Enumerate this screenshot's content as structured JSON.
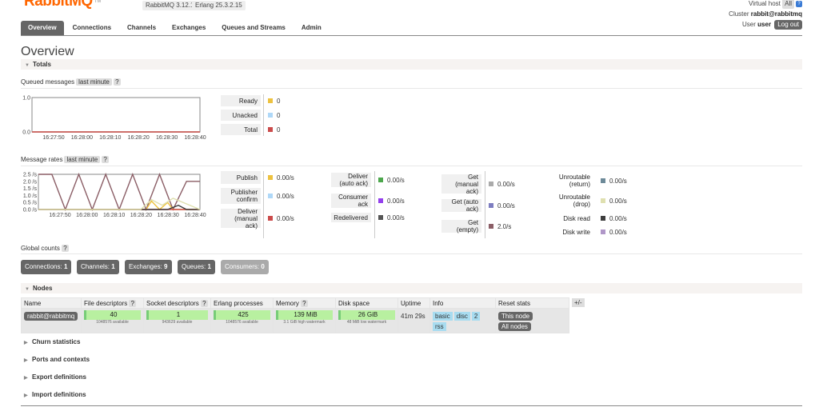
{
  "header": {
    "logo_text": "RabbitMQ",
    "logo_tm": "TM",
    "rabbitmq_version": "RabbitMQ 3.12.14",
    "erlang_version": "Erlang 25.3.2.15",
    "virtual_host_label": "Virtual host",
    "virtual_host_value": "All",
    "cluster_label": "Cluster",
    "cluster_value": "rabbit@rabbitmq",
    "user_label": "User",
    "user_value": "user",
    "logout_label": "Log out",
    "help_glyph": "?"
  },
  "tabs": [
    {
      "label": "Overview",
      "active": true
    },
    {
      "label": "Connections"
    },
    {
      "label": "Channels"
    },
    {
      "label": "Exchanges"
    },
    {
      "label": "Queues and Streams"
    },
    {
      "label": "Admin"
    }
  ],
  "page_title": "Overview",
  "totals": {
    "section_label": "Totals",
    "queued": {
      "label": "Queued messages",
      "range": "last minute",
      "help": "?",
      "chart_data": {
        "type": "line",
        "x": [
          "16:27:50",
          "16:28:00",
          "16:28:10",
          "16:28:20",
          "16:28:30",
          "16:28:40"
        ],
        "y_ticks": [
          "1.0",
          "0.0"
        ],
        "ylim": [
          0,
          1
        ],
        "series": [
          {
            "name": "Ready",
            "color": "#edc240",
            "values": [
              0,
              0,
              0,
              0,
              0,
              0
            ]
          },
          {
            "name": "Unacked",
            "color": "#afd8f8",
            "values": [
              0,
              0,
              0,
              0,
              0,
              0
            ]
          },
          {
            "name": "Total",
            "color": "#cb4b4b",
            "values": [
              0,
              0,
              0,
              0,
              0,
              0
            ]
          }
        ]
      },
      "legend": [
        {
          "label": "Ready",
          "value": "0",
          "color": "#edc240"
        },
        {
          "label": "Unacked",
          "value": "0",
          "color": "#afd8f8"
        },
        {
          "label": "Total",
          "value": "0",
          "color": "#cb4b4b"
        }
      ]
    },
    "rates": {
      "label": "Message rates",
      "range": "last minute",
      "help": "?",
      "chart_data": {
        "type": "line",
        "x": [
          "16:27:50",
          "16:28:00",
          "16:28:10",
          "16:28:20",
          "16:28:30",
          "16:28:40"
        ],
        "y_ticks": [
          "2.5 /s",
          "2.0 /s",
          "1.5 /s",
          "1.0 /s",
          "0.5 /s",
          "0.0 /s"
        ],
        "ylim": [
          0,
          2.5
        ],
        "series": [
          {
            "name": "Get (empty)",
            "color": "#8b5e66",
            "points": [
              [
                0,
                2.5
              ],
              [
                5,
                2.5
              ],
              [
                10,
                0
              ],
              [
                15,
                2.5
              ],
              [
                20,
                0
              ],
              [
                25,
                2.5
              ],
              [
                30,
                0
              ],
              [
                35,
                2.5
              ],
              [
                40,
                0
              ],
              [
                45,
                2.5
              ],
              [
                50,
                0
              ],
              [
                55,
                2.0
              ],
              [
                60,
                2.0
              ]
            ]
          },
          {
            "name": "Publish",
            "color": "#edc240",
            "points": [
              [
                0,
                0
              ],
              [
                40,
                0
              ],
              [
                42,
                0.6
              ],
              [
                45,
                0
              ],
              [
                48,
                0.5
              ],
              [
                50,
                0
              ],
              [
                60,
                0
              ]
            ]
          },
          {
            "name": "Deliver (manual ack)",
            "color": "#cb4b4b",
            "points": [
              [
                0,
                0
              ],
              [
                60,
                0
              ]
            ]
          },
          {
            "name": "Disk read",
            "color": "#3d3d3d",
            "points": [
              [
                0,
                0
              ],
              [
                48,
                0
              ],
              [
                52,
                0.3
              ],
              [
                55,
                0
              ],
              [
                60,
                0
              ]
            ]
          },
          {
            "name": "Unroutable (drop)",
            "color": "#dfe0b0",
            "points": [
              [
                0,
                0
              ],
              [
                38,
                0
              ],
              [
                42,
                0.7
              ],
              [
                46,
                0.3
              ],
              [
                50,
                0.8
              ],
              [
                60,
                0
              ]
            ]
          }
        ]
      },
      "legend_cols": [
        [
          {
            "label": "Publish",
            "value": "0.00/s",
            "color": "#edc240"
          },
          {
            "label": "Publisher confirm",
            "value": "0.00/s",
            "color": "#afd8f8"
          },
          {
            "label": "Deliver (manual ack)",
            "value": "0.00/s",
            "color": "#cb4b4b"
          }
        ],
        [
          {
            "label": "Deliver (auto ack)",
            "value": "0.00/s",
            "color": "#4da74d"
          },
          {
            "label": "Consumer ack",
            "value": "0.00/s",
            "color": "#9440ed"
          },
          {
            "label": "Redelivered",
            "value": "0.00/s",
            "color": "#555555"
          }
        ],
        [
          {
            "label": "Get (manual ack)",
            "value": "0.00/s",
            "color": "#aaaaaa"
          },
          {
            "label": "Get (auto ack)",
            "value": "0.00/s",
            "color": "#7d7dc0"
          },
          {
            "label": "Get (empty)",
            "value": "2.0/s",
            "color": "#8b5e66"
          }
        ],
        [
          {
            "label": "Unroutable (return)",
            "value": "0.00/s",
            "color": "#6d8a99"
          },
          {
            "label": "Unroutable (drop)",
            "value": "0.00/s",
            "color": "#dfe0b0"
          },
          {
            "label": "Disk read",
            "value": "0.00/s",
            "color": "#3d3d3d"
          },
          {
            "label": "Disk write",
            "value": "0.00/s",
            "color": "#b097c8"
          }
        ]
      ]
    },
    "global_counts": {
      "label": "Global counts",
      "help": "?",
      "items": [
        {
          "label": "Connections:",
          "value": "1"
        },
        {
          "label": "Channels:",
          "value": "1"
        },
        {
          "label": "Exchanges:",
          "value": "9"
        },
        {
          "label": "Queues:",
          "value": "1"
        },
        {
          "label": "Consumers:",
          "value": "0"
        }
      ]
    }
  },
  "nodes": {
    "section_label": "Nodes",
    "columns": [
      "Name",
      "File descriptors",
      "Socket descriptors",
      "Erlang processes",
      "Memory",
      "Disk space",
      "Uptime",
      "Info",
      "Reset stats"
    ],
    "plus_minus": "+/-",
    "row": {
      "name": "rabbit@rabbitmq",
      "fd_value": "40",
      "fd_sub": "1048576 available",
      "sd_value": "1",
      "sd_sub": "943629 available",
      "ep_value": "425",
      "ep_sub": "1048576 available",
      "mem_value": "139 MiB",
      "mem_sub": "3.1 GiB high watermark",
      "disk_value": "26 GiB",
      "disk_sub": "48 MiB low watermark",
      "uptime": "41m 29s",
      "info_tags": [
        "basic",
        "disc",
        "2",
        "rss"
      ],
      "reset_this": "This node",
      "reset_all": "All nodes"
    }
  },
  "collapsed_sections": [
    "Churn statistics",
    "Ports and contexts",
    "Export definitions",
    "Import definitions"
  ]
}
